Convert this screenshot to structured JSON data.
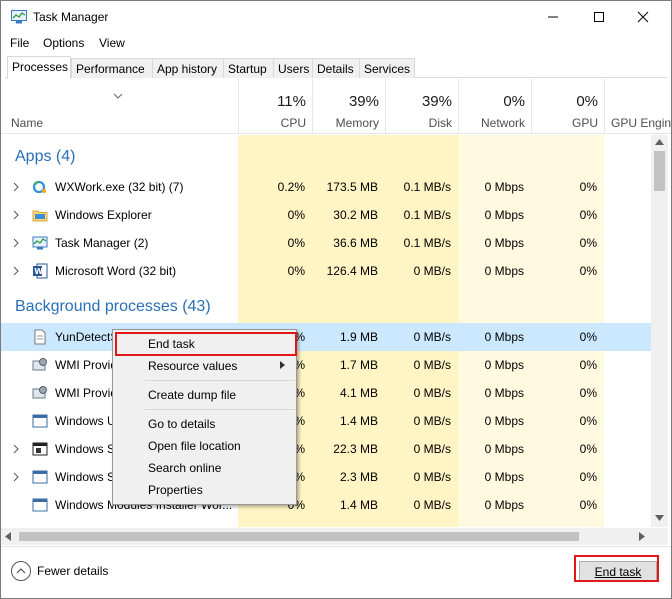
{
  "window": {
    "title": "Task Manager"
  },
  "menu": [
    "File",
    "Options",
    "View"
  ],
  "tabs": [
    "Processes",
    "Performance",
    "App history",
    "Startup",
    "Users",
    "Details",
    "Services"
  ],
  "header": {
    "name": "Name",
    "cpu": {
      "pct": "11%",
      "label": "CPU"
    },
    "memory": {
      "pct": "39%",
      "label": "Memory"
    },
    "disk": {
      "pct": "39%",
      "label": "Disk"
    },
    "network": {
      "pct": "0%",
      "label": "Network"
    },
    "gpu": {
      "pct": "0%",
      "label": "GPU"
    },
    "gpu_engine": {
      "label": "GPU Engine"
    }
  },
  "groups": {
    "apps": "Apps (4)",
    "background": "Background processes (43)"
  },
  "apps": [
    {
      "name": "WXWork.exe (32 bit) (7)",
      "cpu": "0.2%",
      "memory": "173.5 MB",
      "disk": "0.1 MB/s",
      "network": "0 Mbps",
      "gpu": "0%",
      "icon": "wxwork-icon"
    },
    {
      "name": "Windows Explorer",
      "cpu": "0%",
      "memory": "30.2 MB",
      "disk": "0.1 MB/s",
      "network": "0 Mbps",
      "gpu": "0%",
      "icon": "folder-icon"
    },
    {
      "name": "Task Manager (2)",
      "cpu": "0%",
      "memory": "36.6 MB",
      "disk": "0.1 MB/s",
      "network": "0 Mbps",
      "gpu": "0%",
      "icon": "task-manager-icon"
    },
    {
      "name": "Microsoft Word (32 bit)",
      "cpu": "0%",
      "memory": "126.4 MB",
      "disk": "0 MB/s",
      "network": "0 Mbps",
      "gpu": "0%",
      "icon": "word-icon"
    }
  ],
  "background": [
    {
      "name": "YunDetectS",
      "cpu": "%",
      "memory": "1.9 MB",
      "disk": "0 MB/s",
      "network": "0 Mbps",
      "gpu": "0%",
      "selected": true
    },
    {
      "name": "WMI Provid",
      "cpu": "%",
      "memory": "1.7 MB",
      "disk": "0 MB/s",
      "network": "0 Mbps",
      "gpu": "0%"
    },
    {
      "name": "WMI Provid",
      "cpu": "%",
      "memory": "4.1 MB",
      "disk": "0 MB/s",
      "network": "0 Mbps",
      "gpu": "0%"
    },
    {
      "name": "Windows U",
      "cpu": "%",
      "memory": "1.4 MB",
      "disk": "0 MB/s",
      "network": "0 Mbps",
      "gpu": "0%"
    },
    {
      "name": "Windows S",
      "cpu": "%",
      "memory": "22.3 MB",
      "disk": "0 MB/s",
      "network": "0 Mbps",
      "gpu": "0%"
    },
    {
      "name": "Windows S",
      "cpu": "%",
      "memory": "2.3 MB",
      "disk": "0 MB/s",
      "network": "0 Mbps",
      "gpu": "0%"
    },
    {
      "name": "Windows Modules Installer Wor...",
      "cpu": "0%",
      "memory": "1.4 MB",
      "disk": "0 MB/s",
      "network": "0 Mbps",
      "gpu": "0%"
    }
  ],
  "context_menu": [
    "End task",
    "Resource values",
    "Create dump file",
    "Go to details",
    "Open file location",
    "Search online",
    "Properties"
  ],
  "footer": {
    "fewer_details": "Fewer details",
    "end_task": "End task"
  },
  "colors": {
    "accent_blue": "#2a6fb7",
    "highlight_red": "#e01818",
    "selection": "#cce8ff",
    "heat_yellow": "#fff4c4"
  }
}
